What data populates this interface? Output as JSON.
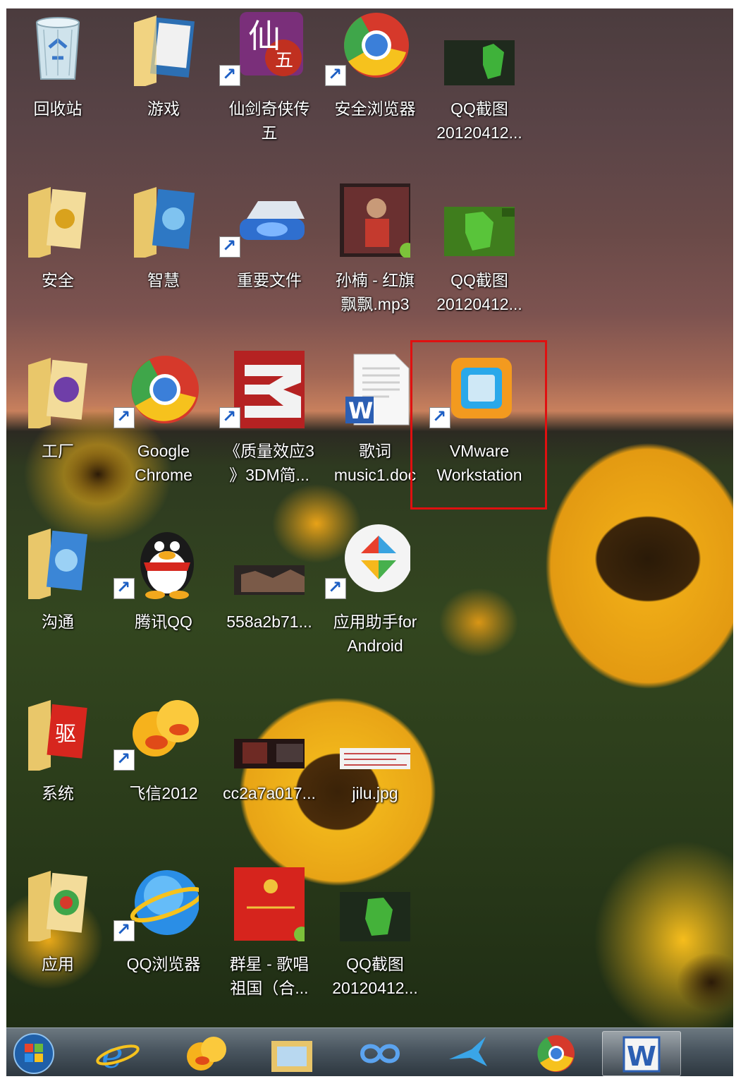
{
  "desktop_icons": [
    {
      "label": "回收站",
      "icon": "recycle-bin-icon"
    },
    {
      "label": "游戏",
      "icon": "folder-icon"
    },
    {
      "label": "仙剑奇侠传\n五",
      "icon": "game-shortcut-icon"
    },
    {
      "label": "安全浏览器",
      "icon": "browser-icon"
    },
    {
      "label": "QQ截图\n20120412...",
      "icon": "image-thumbnail-icon"
    },
    {
      "label": "安全",
      "icon": "folder-icon"
    },
    {
      "label": "智慧",
      "icon": "folder-icon"
    },
    {
      "label": "重要文件",
      "icon": "drive-shortcut-icon"
    },
    {
      "label": "孙楠 - 红旗\n飘飘.mp3",
      "icon": "audio-file-icon"
    },
    {
      "label": "QQ截图\n20120412...",
      "icon": "image-thumbnail-icon"
    },
    {
      "label": "工厂",
      "icon": "folder-icon"
    },
    {
      "label": "Google\nChrome",
      "icon": "chrome-icon"
    },
    {
      "label": "《质量效应3\n》3DM简...",
      "icon": "game-shortcut-icon"
    },
    {
      "label": "歌词\nmusic1.doc",
      "icon": "word-document-icon"
    },
    {
      "label": "VMware\nWorkstation",
      "icon": "vmware-icon"
    },
    {
      "label": "沟通",
      "icon": "folder-icon"
    },
    {
      "label": "腾讯QQ",
      "icon": "qq-penguin-icon"
    },
    {
      "label": "558a2b71...",
      "icon": "image-thumbnail-icon"
    },
    {
      "label": "应用助手for\nAndroid",
      "icon": "app-assistant-icon"
    },
    {
      "label": "系统",
      "icon": "folder-icon"
    },
    {
      "label": "飞信2012",
      "icon": "fetion-icon"
    },
    {
      "label": "cc2a7a017...",
      "icon": "image-thumbnail-icon"
    },
    {
      "label": "jilu.jpg",
      "icon": "image-thumbnail-icon"
    },
    {
      "label": "应用",
      "icon": "folder-icon"
    },
    {
      "label": "QQ浏览器",
      "icon": "qq-browser-icon"
    },
    {
      "label": "群星 - 歌唱\n祖国（合...",
      "icon": "audio-file-icon"
    },
    {
      "label": "QQ截图\n20120412...",
      "icon": "image-thumbnail-icon"
    }
  ],
  "highlighted_icon": "VMware Workstation",
  "highlight_color": "#e01010",
  "taskbar": [
    {
      "icon": "start-orb-icon"
    },
    {
      "icon": "internet-explorer-icon"
    },
    {
      "icon": "fetion-icon"
    },
    {
      "icon": "file-explorer-icon"
    },
    {
      "icon": "infinity-app-icon"
    },
    {
      "icon": "bird-app-icon"
    },
    {
      "icon": "chrome-icon"
    },
    {
      "icon": "word-icon",
      "active": true
    }
  ]
}
